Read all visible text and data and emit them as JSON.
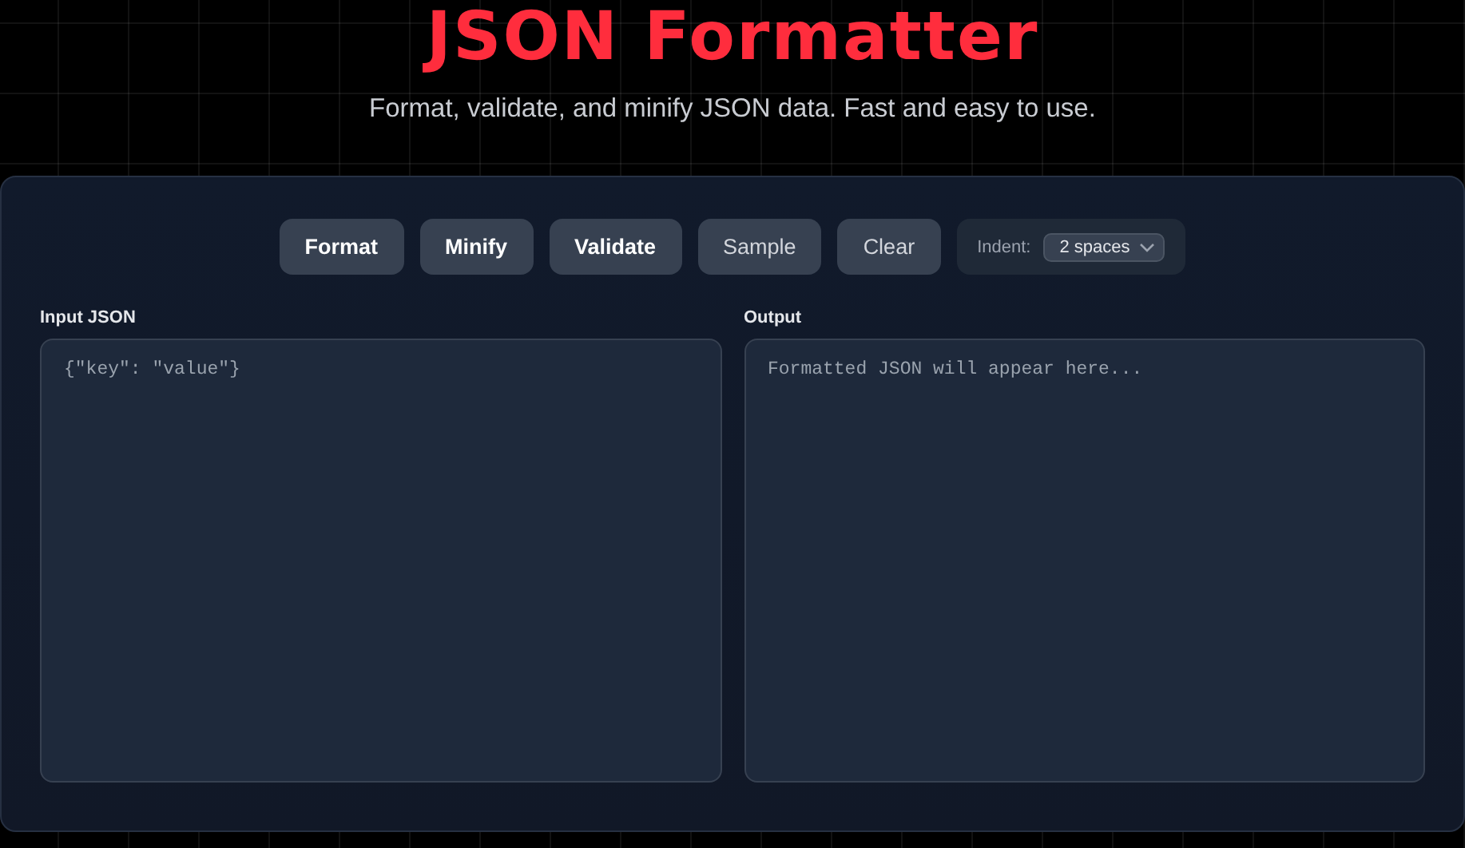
{
  "header": {
    "title": "JSON Formatter",
    "subtitle": "Format, validate, and minify JSON data. Fast and easy to use."
  },
  "toolbar": {
    "buttons": [
      {
        "label": "Format",
        "kind": "primary"
      },
      {
        "label": "Minify",
        "kind": "primary"
      },
      {
        "label": "Validate",
        "kind": "primary"
      },
      {
        "label": "Sample",
        "kind": "secondary"
      },
      {
        "label": "Clear",
        "kind": "secondary"
      }
    ],
    "indent": {
      "label": "Indent:",
      "value": "2 spaces"
    }
  },
  "panes": [
    {
      "label": "Input JSON",
      "placeholder": "{\"key\": \"value\"}"
    },
    {
      "label": "Output",
      "placeholder": "Formatted JSON will appear here..."
    }
  ]
}
